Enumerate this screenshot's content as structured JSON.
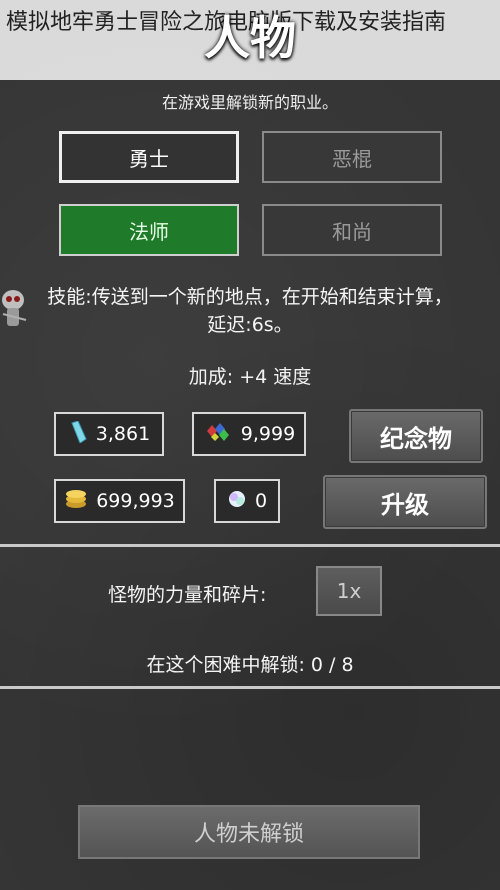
{
  "overlay_title": "模拟地牢勇士冒险之旅电脑版下载及安装指南",
  "screen_title": "人物",
  "subtitle": "在游戏里解锁新的职业。",
  "classes": [
    {
      "label": "勇士"
    },
    {
      "label": "恶棍"
    },
    {
      "label": "法师"
    },
    {
      "label": "和尚"
    }
  ],
  "skill_text_line1": "技能:传送到一个新的地点，在开始和结束计算，",
  "skill_text_line2": "延迟:6s。",
  "bonus_text": "加成: +4 速度",
  "resources": {
    "crystals": "3,861",
    "gems": "9,999",
    "gold": "699,993",
    "orbs": "0"
  },
  "buttons": {
    "souvenir": "纪念物",
    "upgrade": "升级",
    "multiplier": "1x",
    "character_locked": "人物未解锁"
  },
  "monster_power_label": "怪物的力量和碎片:",
  "unlock_progress_text": "在这个困难中解锁: 0 / 8",
  "icons": {
    "crystal": "crystal-icon",
    "gems": "gems-icon",
    "gold": "gold-icon",
    "orb": "orb-icon"
  },
  "colors": {
    "background": "#353535",
    "active_class": "#1f7a2a"
  }
}
